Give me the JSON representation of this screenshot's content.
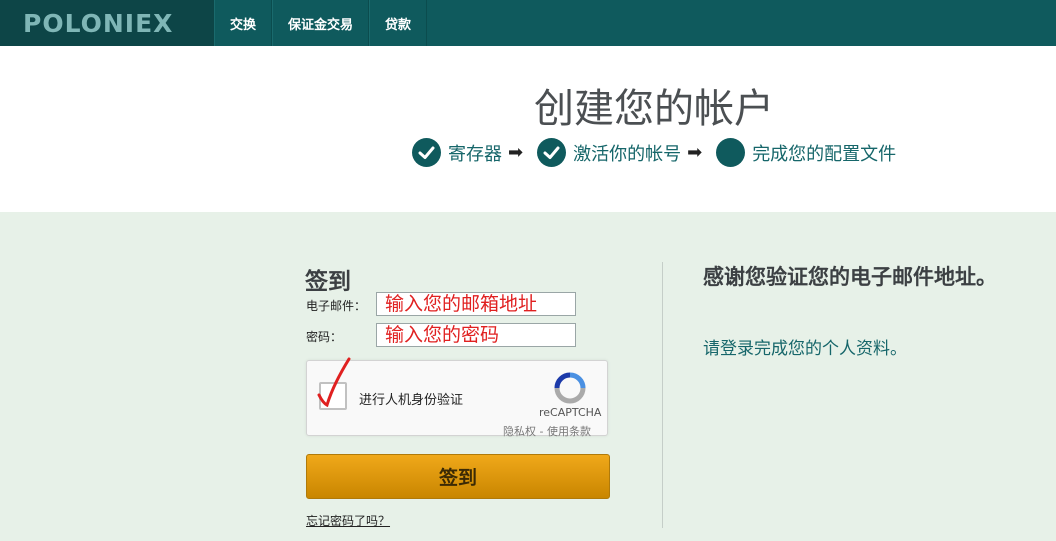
{
  "topbar": {
    "logo": "POLONIEX",
    "nav": [
      "交换",
      "保证金交易",
      "贷款"
    ]
  },
  "header": {
    "title": "创建您的帐户",
    "steps": [
      {
        "label": "寄存器",
        "state": "done"
      },
      {
        "label": "激活你的帐号",
        "state": "done"
      },
      {
        "label": "完成您的配置文件",
        "state": "current"
      }
    ],
    "arrow": "➡"
  },
  "login": {
    "title": "签到",
    "email_label": "电子邮件：",
    "email_value": "输入您的邮箱地址",
    "password_label": "密码：",
    "password_value": "输入您的密码",
    "captcha_text": "进行人机身份验证",
    "captcha_brand": "reCAPTCHA",
    "captcha_terms": "隐私权 - 使用条款",
    "submit_label": "签到",
    "forgot_label": "忘记密码了吗？"
  },
  "thanks": {
    "title": "感谢您验证您的电子邮件地址。",
    "subtitle": "请登录完成您的个人资料。"
  },
  "colors": {
    "brand": "#0f5a5d",
    "accent": "#e8a010",
    "background": "#e7f1e8"
  }
}
